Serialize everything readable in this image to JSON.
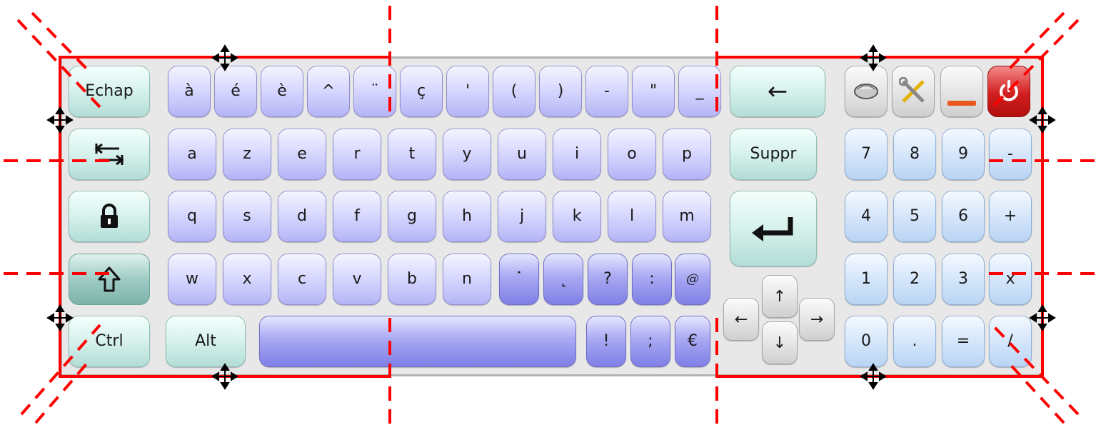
{
  "row1": {
    "escape": "Echap",
    "keys": [
      "à",
      "é",
      "è",
      "^",
      "¨",
      "ç",
      "'",
      "(",
      ")",
      "-",
      "\"",
      "_"
    ],
    "backspace": "←"
  },
  "row2": {
    "tab": "tab-icon",
    "keys": [
      "a",
      "z",
      "e",
      "r",
      "t",
      "y",
      "u",
      "i",
      "o",
      "p"
    ],
    "delete": "Suppr"
  },
  "row3": {
    "caps": "lock-icon",
    "keys": [
      "q",
      "s",
      "d",
      "f",
      "g",
      "h",
      "j",
      "k",
      "l",
      "m"
    ],
    "enter": "enter-icon"
  },
  "row4": {
    "shift": "shift-icon",
    "keys": [
      "w",
      "x",
      "c",
      "v",
      "b",
      "n",
      "˙",
      "˛",
      "?",
      ":",
      "@"
    ]
  },
  "row5": {
    "ctrl": "Ctrl",
    "alt": "Alt",
    "keys": [
      "!",
      ";",
      "€"
    ]
  },
  "arrows": {
    "up": "↑",
    "left": "←",
    "right": "→",
    "down": "↓"
  },
  "tools": [
    "mouse-icon",
    "tools-icon",
    "minimize-icon",
    "power-icon"
  ],
  "numpad": {
    "row1": [
      "7",
      "8",
      "9",
      "-"
    ],
    "row2": [
      "4",
      "5",
      "6",
      "+"
    ],
    "row3": [
      "1",
      "2",
      "3",
      "x"
    ],
    "row4": [
      "0",
      ".",
      "=",
      "/"
    ]
  },
  "colors": {
    "overlay_red": "#ff0000",
    "lavender": "#c7c7fb",
    "mint": "#cdeee8",
    "sky": "#cfe2f8",
    "power": "#d21e1e"
  }
}
